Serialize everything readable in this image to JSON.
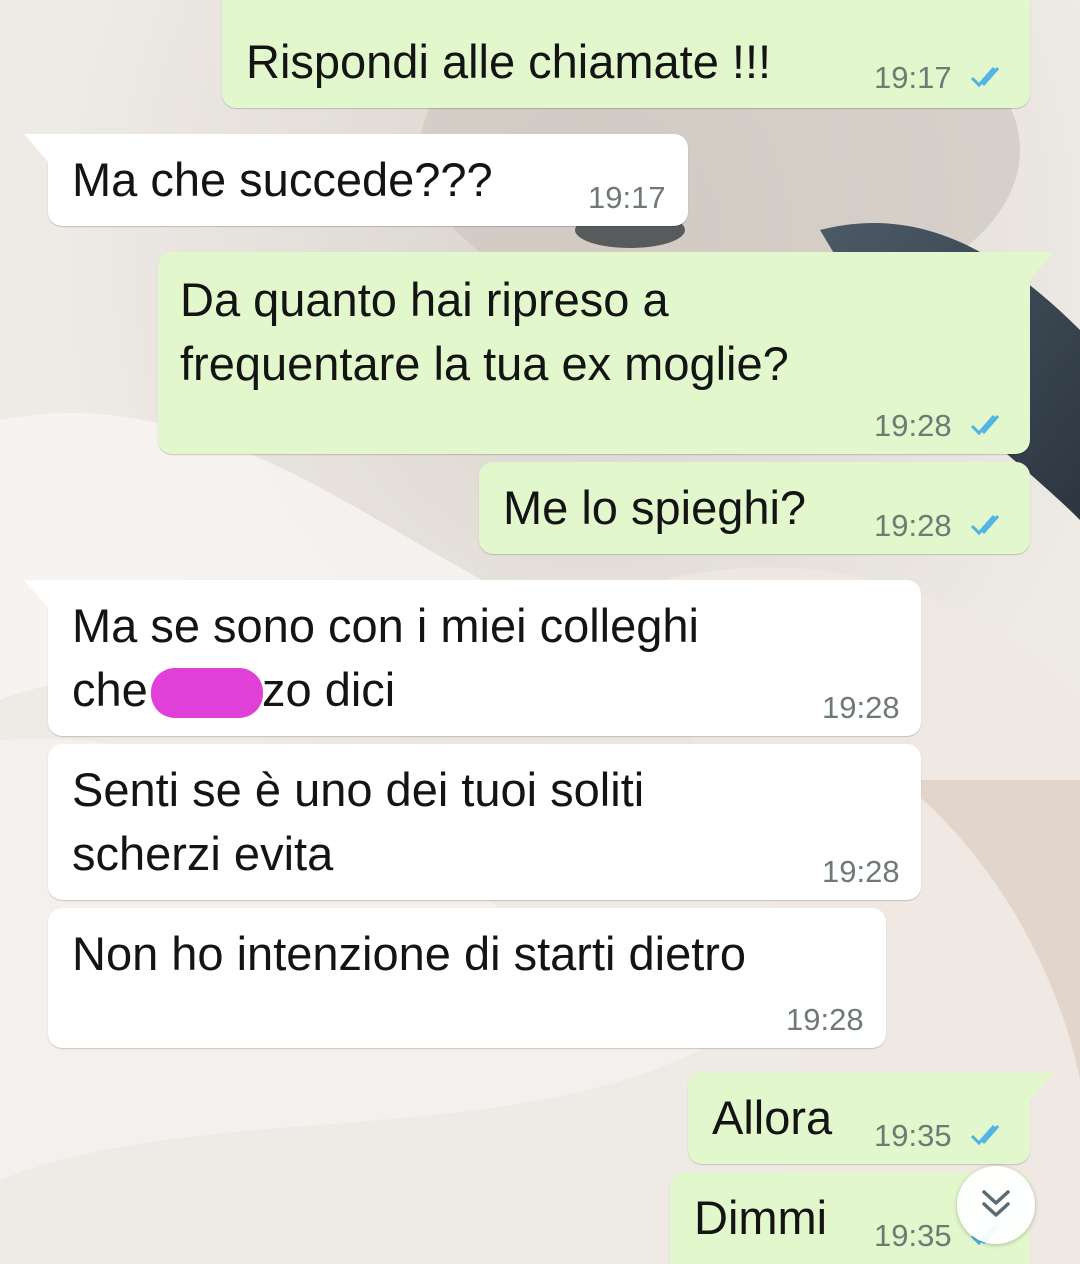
{
  "colors": {
    "outgoing_bubble": "#e2f7cb",
    "incoming_bubble": "#ffffff",
    "read_ticks": "#4fb3e6",
    "redaction": "#e03fd8",
    "timestamp": "#6f7a75"
  },
  "messages": [
    {
      "direction": "outgoing",
      "lines": [
        "Rispondi alle chiamate !!!"
      ],
      "time": "19:17",
      "status": "read"
    },
    {
      "direction": "incoming",
      "lines": [
        "Ma che succede???"
      ],
      "time": "19:17"
    },
    {
      "direction": "outgoing",
      "lines": [
        "Da quanto hai ripreso a",
        "frequentare la tua ex moglie?"
      ],
      "time": "19:28",
      "status": "read"
    },
    {
      "direction": "outgoing",
      "lines": [
        "Me lo spieghi?"
      ],
      "time": "19:28",
      "status": "read"
    },
    {
      "direction": "incoming",
      "lines": [
        "Ma se sono con i miei colleghi",
        "che",
        "zo dici"
      ],
      "time": "19:28",
      "redacted": true
    },
    {
      "direction": "incoming",
      "lines": [
        "Senti se è uno dei tuoi soliti",
        "scherzi evita"
      ],
      "time": "19:28"
    },
    {
      "direction": "incoming",
      "lines": [
        "Non ho intenzione di starti dietro"
      ],
      "time": "19:28"
    },
    {
      "direction": "outgoing",
      "lines": [
        "Allora"
      ],
      "time": "19:35",
      "status": "read"
    },
    {
      "direction": "outgoing",
      "lines": [
        "Dimmi"
      ],
      "time": "19:35",
      "status": "read"
    }
  ],
  "scroll_button": {
    "icon": "double-chevron-down-icon"
  }
}
